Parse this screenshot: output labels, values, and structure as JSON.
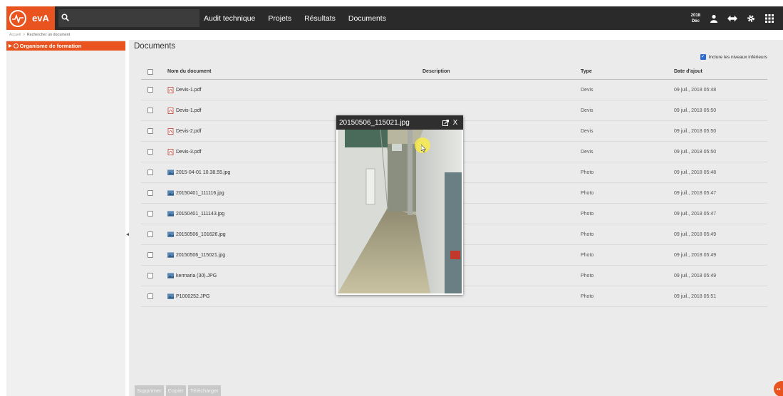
{
  "app": {
    "name": "evA"
  },
  "search": {
    "value": "",
    "placeholder": ""
  },
  "nav": {
    "items": [
      "Audit technique",
      "Projets",
      "Résultats",
      "Documents"
    ]
  },
  "header": {
    "year": "2018",
    "month": "Déc"
  },
  "breadcrumb": {
    "home": "Accueil",
    "separator": ">",
    "current": "Rechercher un document"
  },
  "sidebar": {
    "items": [
      {
        "label": "Organisme de formation"
      }
    ]
  },
  "main": {
    "title": "Documents",
    "include_label": "Inclure les niveaux inférieurs",
    "include_checked": true,
    "columns": {
      "name": "Nom du document",
      "description": "Description",
      "type": "Type",
      "date": "Date d'ajout"
    },
    "rows": [
      {
        "name": "Devis-1.pdf",
        "type": "Devis",
        "date": "09 juil., 2018 05:48",
        "icon": "pdf-icon"
      },
      {
        "name": "Devis-1.pdf",
        "type": "Devis",
        "date": "09 juil., 2018 05:50",
        "icon": "pdf-icon"
      },
      {
        "name": "Devis-2.pdf",
        "type": "Devis",
        "date": "09 juil., 2018 05:50",
        "icon": "pdf-icon"
      },
      {
        "name": "Devis-3.pdf",
        "type": "Devis",
        "date": "09 juil., 2018 05:50",
        "icon": "pdf-icon"
      },
      {
        "name": "2015-04-01 10.38.55.jpg",
        "type": "Photo",
        "date": "09 juil., 2018 05:48",
        "icon": "image-icon"
      },
      {
        "name": "20150401_111116.jpg",
        "type": "Photo",
        "date": "09 juil., 2018 05:47",
        "icon": "image-icon"
      },
      {
        "name": "20150401_111143.jpg",
        "type": "Photo",
        "date": "09 juil., 2018 05:47",
        "icon": "image-icon"
      },
      {
        "name": "20150506_101626.jpg",
        "type": "Photo",
        "date": "09 juil., 2018 05:49",
        "icon": "image-icon"
      },
      {
        "name": "20150506_115021.jpg",
        "type": "Photo",
        "date": "09 juil., 2018 05:49",
        "icon": "image-icon"
      },
      {
        "name": "kermaria (30).JPG",
        "type": "Photo",
        "date": "09 juil., 2018 05:49",
        "icon": "image-icon"
      },
      {
        "name": "P1000252.JPG",
        "type": "Photo",
        "date": "09 juil., 2018 05:51",
        "icon": "image-icon"
      }
    ],
    "actions": {
      "delete": "Supprimer",
      "copy": "Copier",
      "download": "Télécharger"
    }
  },
  "popup": {
    "title": "20150506_115021.jpg",
    "close": "X"
  },
  "colors": {
    "accent": "#e8531f",
    "topbar": "#2a2a2a",
    "checkbox": "#2a6bd1"
  }
}
